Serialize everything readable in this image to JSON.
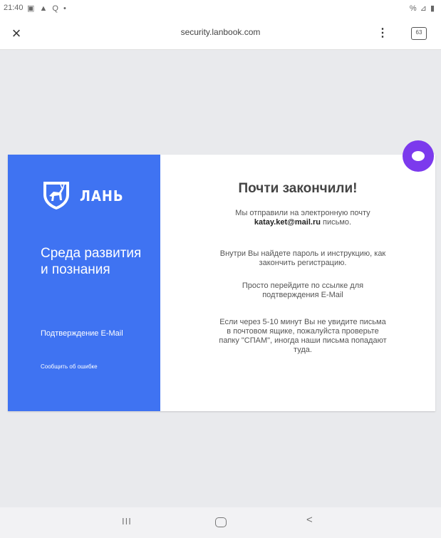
{
  "status_bar": {
    "time": "21:40",
    "left_icons": "▣ ▲ Q •",
    "right_icons": "% ⊿ ▮"
  },
  "browser": {
    "close_label": "×",
    "url": "security.lanbook.com",
    "menu_label": "⋮",
    "tabs_count": "63"
  },
  "brand": {
    "name": "ЛАНЬ",
    "slogan": "Среда развития и познания",
    "confirm_link": "Подтверждение E-Mail",
    "report_link": "Сообщить об ошибке",
    "panel_color": "#3f73f2"
  },
  "message": {
    "title": "Почти закончили!",
    "p1_before": "Мы отправили на электронную почту ",
    "email": "katay.ket@mail.ru",
    "p1_after": " письмо.",
    "p2": "Внутри Вы найдете пароль и инструкцию, как закончить регистрацию.",
    "p3": "Просто перейдите по ссылке для подтверждения E-Mail",
    "p4": "Если через 5-10 минут Вы не увидите письма в почтовом ящике, пожалуйста проверьте папку \"СПАМ\", иногда наши письма попадают туда."
  },
  "assistant": {
    "icon": "alice-assistant-icon",
    "color": "#7c3aed"
  },
  "nav_bar": {
    "recents": "III",
    "back": "<"
  }
}
